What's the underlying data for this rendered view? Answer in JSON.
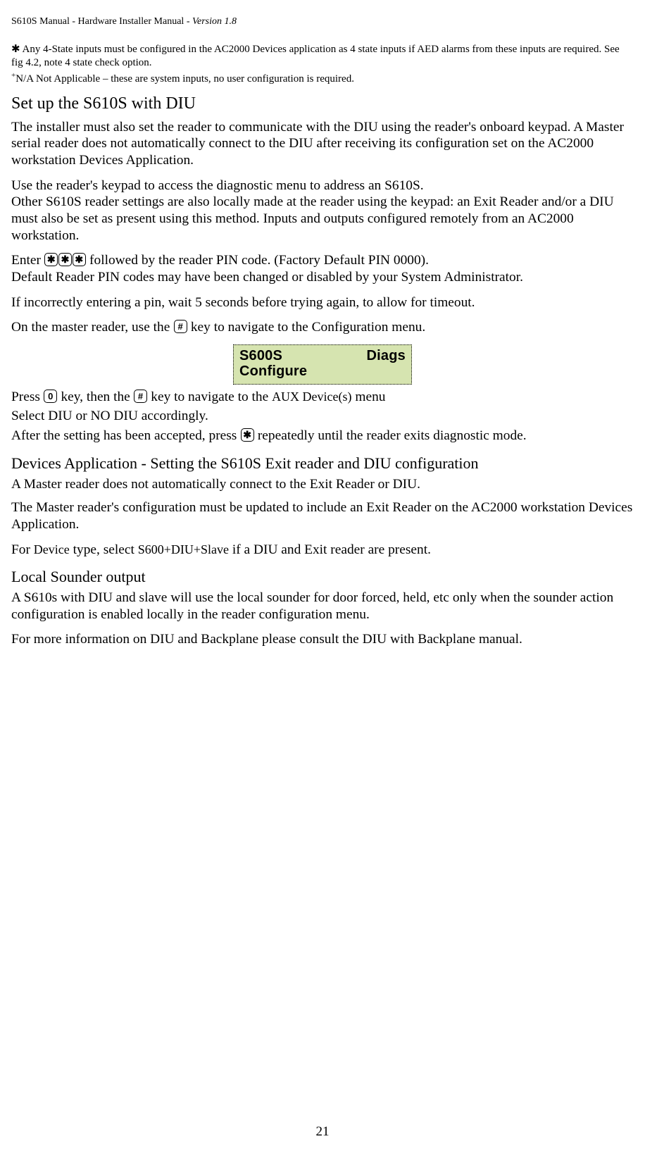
{
  "header": "S610S Manual  - Hardware Installer Manual  - Version 1.8",
  "notes": {
    "asterisk_symbol": "✱",
    "line1": " Any 4-State inputs must be configured in the AC2000 Devices application as 4 state inputs if AED alarms from these inputs are required. See fig 4.2, note 4 state check option.",
    "plus": "+",
    "line2": "N/A Not Applicable – these are system inputs, no user configuration is required."
  },
  "s1": {
    "title": "Set up the S610S with DIU",
    "p1": "The installer must also set the reader to communicate with the DIU using the reader's onboard keypad.  A Master serial reader does not automatically connect to the DIU after receiving its configuration set on the AC2000 workstation Devices Application.",
    "p2a": "Use the reader's keypad to access the diagnostic menu to address an S610S.",
    "p2b": "Other S610S reader settings are also locally made at the reader using the keypad: an Exit Reader and/or a DIU must also be set as present using this method.  Inputs and outputs configured remotely from an AC2000 workstation.",
    "p3a": "Enter ",
    "p3b": " followed by the reader PIN code. (Factory Default PIN 0000).",
    "p3c": "Default Reader PIN codes may have been changed or disabled by your System Administrator.",
    "p4": "If incorrectly entering a pin, wait 5 seconds before trying again, to allow for timeout.",
    "p5a": "On the master reader, use the ",
    "p5b": " key to navigate to the Configuration menu.",
    "display": {
      "l1_left": "S600S",
      "l1_right": "Diags",
      "l2": "Configure"
    },
    "p6a": "Press ",
    "p6b": " key, then the ",
    "p6c": " key to navigate to the ",
    "p6d": "AUX Device(s)",
    "p6e": " menu",
    "p7": "Select DIU or NO DIU accordingly.",
    "p8a": "After the setting has been accepted, press ",
    "p8b": " repeatedly until the reader exits diagnostic mode.",
    "key_star": "✱",
    "key_hash": "#",
    "key_zero": "0"
  },
  "s2": {
    "title": "Devices Application - Setting the S610S Exit reader and DIU configuration",
    "p1": "A Master reader does not automatically connect to the Exit Reader or DIU.",
    "p2": "The Master reader's configuration must be updated to include an Exit Reader on the AC2000 workstation Devices Application.",
    "p3a": "For ",
    "p3b": "Device",
    "p3c": " type, select ",
    "p3d": "S600+DIU+Slave",
    "p3e": " if a DIU and Exit reader are present."
  },
  "s3": {
    "title": "Local Sounder  output",
    "p1": "A S610s with DIU and slave will use the local sounder for door forced, held, etc only when the sounder action configuration is enabled locally in the reader configuration menu.",
    "p2": "For more information on DIU and Backplane please consult the DIU with Backplane manual."
  },
  "page_num": "21"
}
